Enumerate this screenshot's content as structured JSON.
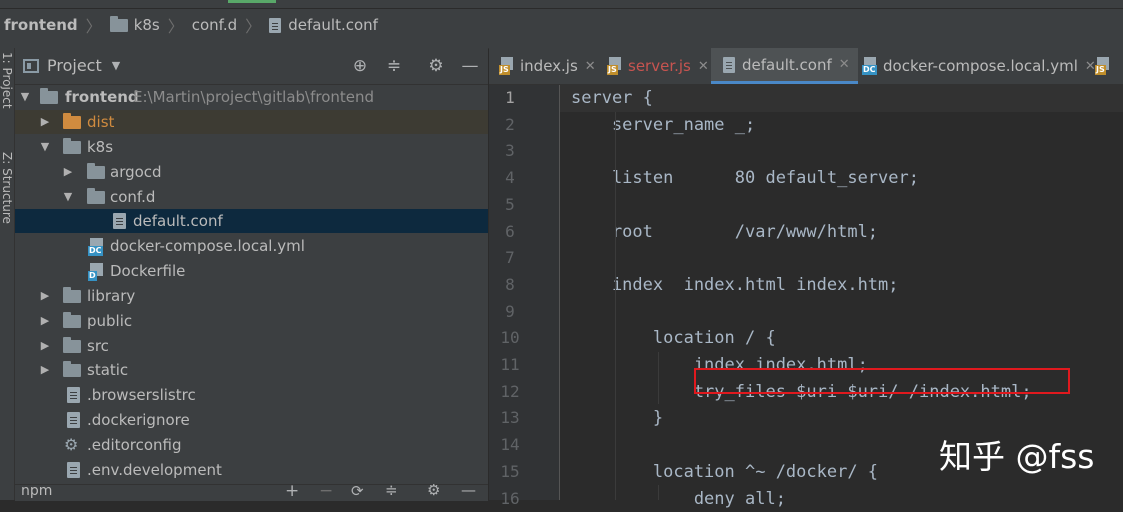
{
  "breadcrumb": {
    "items": [
      "frontend",
      "k8s",
      "conf.d",
      "default.conf"
    ]
  },
  "side_stripe": {
    "project_tab": "1: Project",
    "structure_tab": "Z: Structure"
  },
  "project_panel": {
    "title": "Project",
    "header_icons": [
      "locate-icon",
      "collapse-icon",
      "gear-icon",
      "minimize-icon"
    ],
    "tree": [
      {
        "label": "frontend",
        "path": "E:\\Martin\\project\\gitlab\\frontend"
      },
      {
        "label": "dist"
      },
      {
        "label": "k8s"
      },
      {
        "label": "argocd"
      },
      {
        "label": "conf.d"
      },
      {
        "label": "default.conf"
      },
      {
        "label": "docker-compose.local.yml"
      },
      {
        "label": "Dockerfile"
      },
      {
        "label": "library"
      },
      {
        "label": "public"
      },
      {
        "label": "src"
      },
      {
        "label": "static"
      },
      {
        "label": ".browserslistrc"
      },
      {
        "label": ".dockerignore"
      },
      {
        "label": ".editorconfig"
      },
      {
        "label": ".env.development"
      }
    ],
    "bottom_label": "npm"
  },
  "editor": {
    "tabs": [
      {
        "label": "index.js"
      },
      {
        "label": "server.js"
      },
      {
        "label": "default.conf"
      },
      {
        "label": "docker-compose.local.yml"
      }
    ],
    "line_numbers": [
      "1",
      "2",
      "3",
      "4",
      "5",
      "6",
      "7",
      "8",
      "9",
      "10",
      "11",
      "12",
      "13",
      "14",
      "15",
      "16"
    ],
    "lines": [
      "server {",
      "    server_name _;",
      "",
      "    listen      80 default_server;",
      "",
      "    root        /var/www/html;",
      "",
      "    index  index.html index.htm;",
      "",
      "        location / {",
      "            index index.html;",
      "            try_files $uri $uri/ /index.html;",
      "        }",
      "",
      "        location ^~ /docker/ {",
      "            deny all;"
    ]
  },
  "watermark": "知乎 @fss",
  "colors": {
    "highlight_box": "#e0191e",
    "active_tab_underline": "#4a88c7",
    "error_tab_text": "#c75450",
    "dist_folder": "#d08b3f"
  }
}
